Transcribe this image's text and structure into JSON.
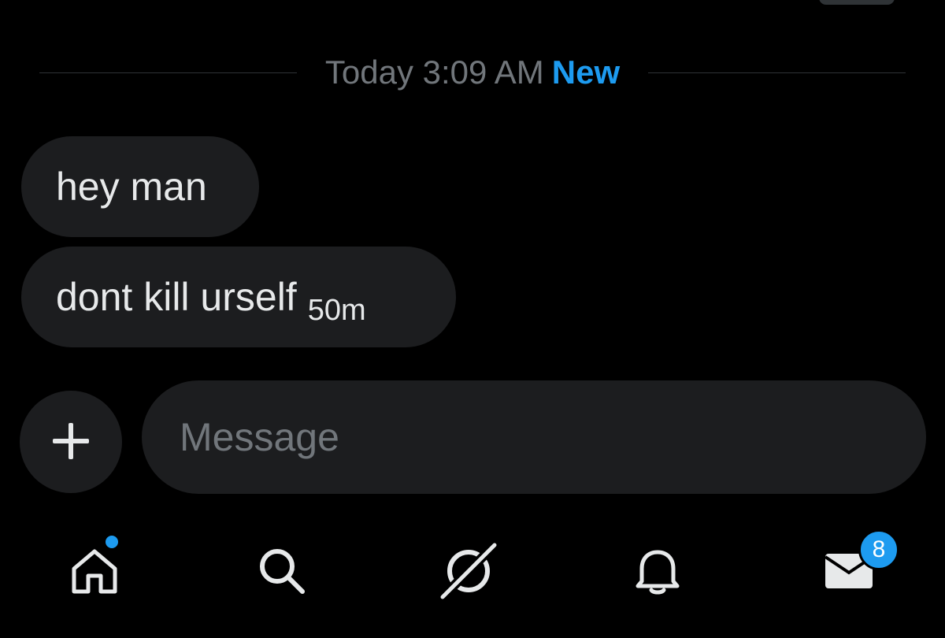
{
  "divider": {
    "timestamp": "Today 3:09 AM",
    "new_label": "New"
  },
  "messages": [
    {
      "text": "hey man",
      "time": ""
    },
    {
      "text": "dont kill urself",
      "time": "50m"
    }
  ],
  "composer": {
    "placeholder": "Message",
    "value": ""
  },
  "nav": {
    "items": [
      {
        "icon": "home-icon",
        "has_dot": true
      },
      {
        "icon": "search-icon"
      },
      {
        "icon": "grok-icon"
      },
      {
        "icon": "bell-icon"
      },
      {
        "icon": "mail-icon",
        "badge": "8"
      }
    ]
  },
  "colors": {
    "background": "#000000",
    "bubble": "#1c1d1f",
    "accent": "#1d9bf0",
    "muted": "#71767b",
    "text": "#e7e9ea"
  }
}
